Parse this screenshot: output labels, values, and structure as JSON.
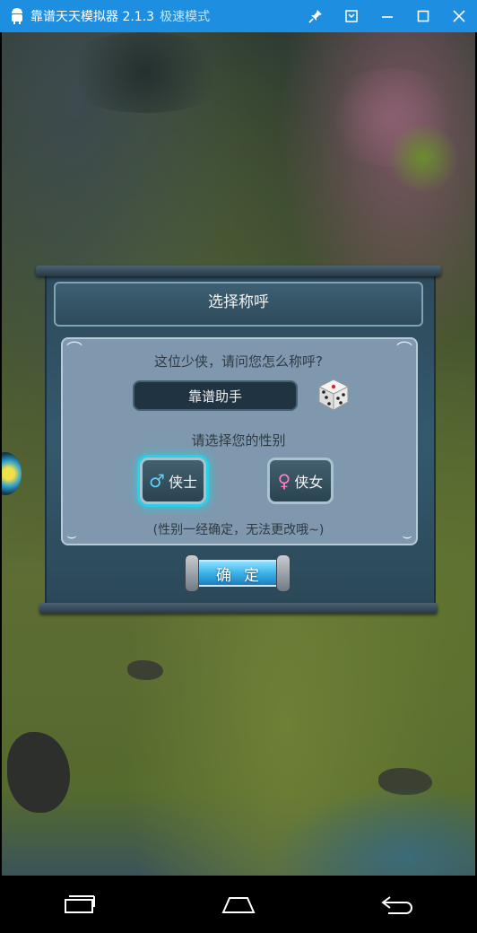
{
  "titlebar": {
    "app_title": "靠谱天天模拟器 2.1.3",
    "mode_label": "极速模式",
    "icons": [
      "android-logo-icon",
      "pin-icon",
      "collapse-icon",
      "minimize-icon",
      "maximize-icon",
      "close-icon"
    ]
  },
  "dialog": {
    "title": "选择称呼",
    "question": "这位少侠，请问您怎么称呼?",
    "name_value": "靠谱助手",
    "gender_prompt": "请选择您的性别",
    "male_label": "侠士",
    "male_symbol": "♂",
    "female_label": "侠女",
    "female_symbol": "♀",
    "selected_gender": "male",
    "note": "(性别一经确定，无法更改哦~)",
    "confirm_label": "确定"
  },
  "navbar": {
    "icons": [
      "recent-apps-icon",
      "home-icon",
      "back-icon"
    ]
  },
  "colors": {
    "titlebar_bg": "#1e8fe0",
    "mode_text": "#bfe6ff",
    "selection_glow": "#2bd0e4",
    "male_symbol": "#55d6ff",
    "female_symbol": "#ff7ec8"
  }
}
